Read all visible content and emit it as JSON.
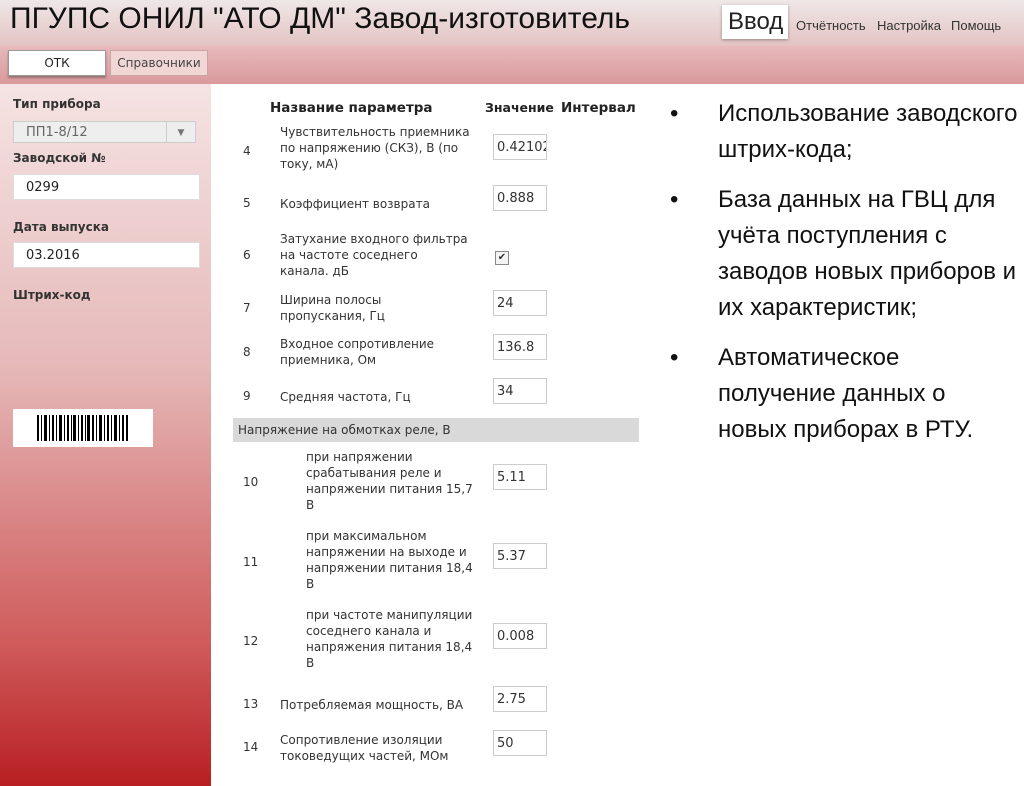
{
  "window": {
    "title": "ПГУПС ОНИЛ \"АТО ДМ\" Завод-изготовитель"
  },
  "menu": {
    "input": "Ввод",
    "items": [
      "Отчётность",
      "Настройка",
      "Помощь"
    ]
  },
  "tabs": [
    "ОТК",
    "Справочники"
  ],
  "sidebar": {
    "device_type_label": "Тип прибора",
    "device_type_value": "ПП1-8/12",
    "serial_label": "Заводской №",
    "serial_value": "0299",
    "date_label": "Дата выпуска",
    "date_value": "03.2016",
    "barcode_label": "Штрих-код"
  },
  "table": {
    "headers": {
      "name": "Название параметра",
      "value": "Значение",
      "interval": "Интервал"
    },
    "rows": [
      {
        "num": "4",
        "name": "Чувствительность приемника по напряжению (СКЗ), В (по току, мА)",
        "value": "0.42102"
      },
      {
        "num": "5",
        "name": "Коэффициент возврата",
        "value": "0.888"
      },
      {
        "num": "6",
        "name": "Затухание входного фильтра на частоте соседнего канала. дБ",
        "value": "✔"
      },
      {
        "num": "7",
        "name": "Ширина полосы пропускания, Гц",
        "value": "24"
      },
      {
        "num": "8",
        "name": "Входное сопротивление приемника, Ом",
        "value": "136.8"
      },
      {
        "num": "9",
        "name": "Средняя частота, Гц",
        "value": "34"
      }
    ],
    "group_label": "Напряжение на обмотках реле, В",
    "group_rows": [
      {
        "num": "10",
        "name": "при напряжении срабатывания реле и напряжении питания 15,7 В",
        "value": "5.11"
      },
      {
        "num": "11",
        "name": "при максимальном напряжении на выходе и напряжении питания 18,4 В",
        "value": "5.37"
      },
      {
        "num": "12",
        "name": "при частоте манипуляции соседнего канала и напряжения питания 18,4 В",
        "value": "0.008"
      },
      {
        "num": "13",
        "name": "Потребляемая мощность, ВА",
        "value": "2.75"
      },
      {
        "num": "14",
        "name": "Сопротивление изоляции токоведущих частей, МОм",
        "value": "50"
      }
    ]
  },
  "bullets": [
    "Использование заводского штрих-кода;",
    "База данных на ГВЦ для учёта поступления с заводов новых приборов и их характеристик;",
    "Автоматическое получение данных о новых приборах в РТУ."
  ],
  "icons": {
    "dropdown": "chevron-down-icon",
    "check": "check-icon",
    "bullet": "bullet-icon"
  },
  "colors": {
    "accent_dark": "#b81f22",
    "tabbar": "#e0a9ab",
    "group_row": "#d9d9d9"
  }
}
